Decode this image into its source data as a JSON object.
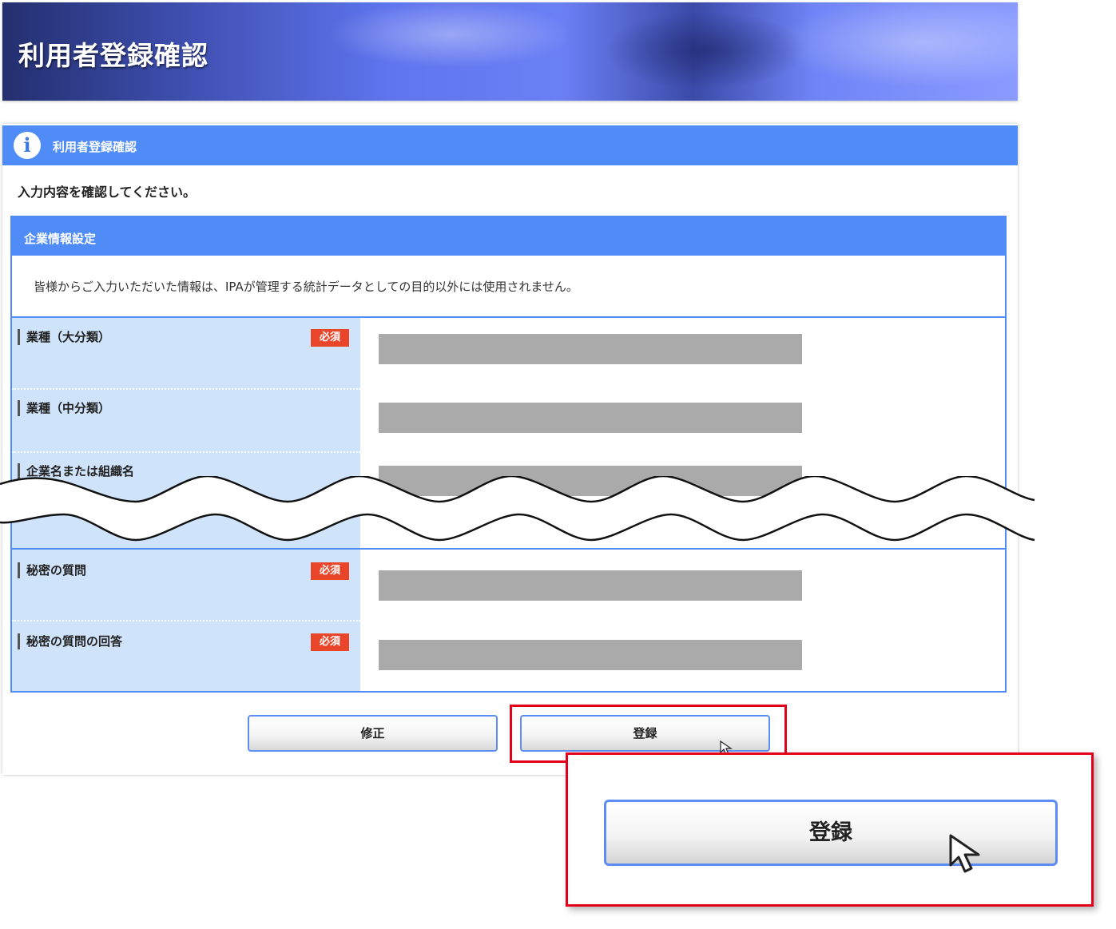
{
  "banner": {
    "title": "利用者登録確認"
  },
  "panel": {
    "header_title": "利用者登録確認",
    "info_icon": "info-icon",
    "instruction": "入力内容を確認してください。"
  },
  "section": {
    "title": "企業情報設定",
    "notice": "皆様からご入力いただいた情報は、IPAが管理する統計データとしての目的以外には使用されません。",
    "required_label": "必須",
    "fields": [
      {
        "label": "業種（大分類）",
        "required": true
      },
      {
        "label": "業種（中分類）",
        "required": false
      },
      {
        "label": "企業名または組織名",
        "required": false
      },
      {
        "label": "秘密の質問",
        "required": true
      },
      {
        "label": "秘密の質問の回答",
        "required": true
      }
    ]
  },
  "buttons": {
    "modify": "修正",
    "register": "登録"
  },
  "zoom": {
    "register": "登録"
  },
  "colors": {
    "accent": "#4f8cf7",
    "label_bg": "#cfe3fb",
    "required": "#e8452a",
    "highlight": "#e3001b"
  }
}
